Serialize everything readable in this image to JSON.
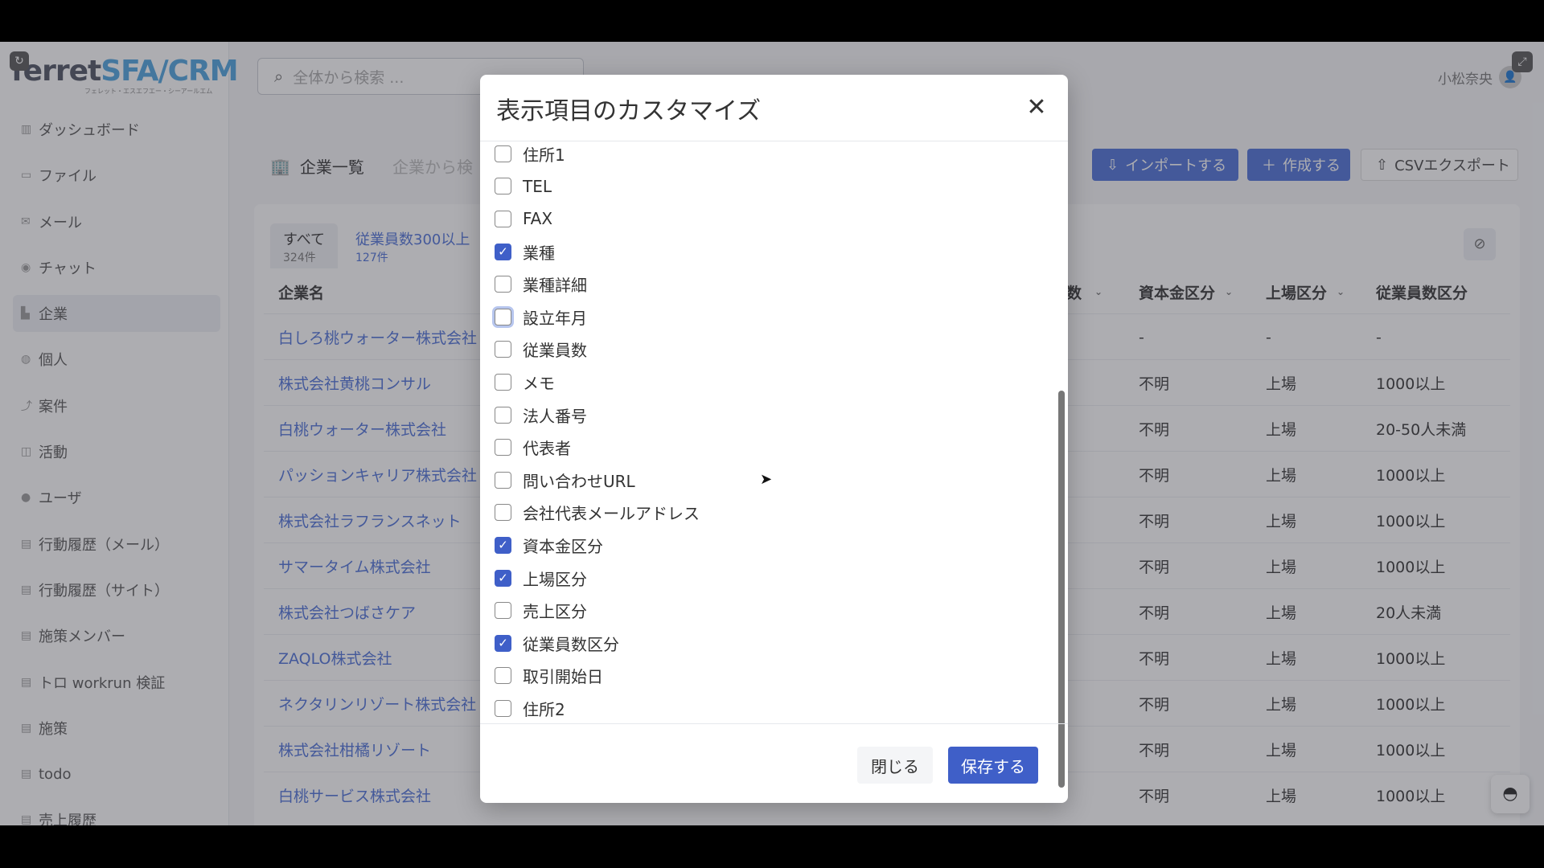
{
  "app": {
    "logo_main": "ferret",
    "logo_accent": "SFA/CRM",
    "logo_sub": "フェレット・エスエフエー・シーアールエム",
    "search_placeholder": "全体から検索 ...",
    "user_name": "小松奈央"
  },
  "sidebar": {
    "items": [
      {
        "icon": "chart-icon",
        "label": "ダッシュボード"
      },
      {
        "icon": "folder-icon",
        "label": "ファイル"
      },
      {
        "icon": "mail-icon",
        "label": "メール"
      },
      {
        "icon": "chat-icon",
        "label": "チャット"
      },
      {
        "icon": "building-icon",
        "label": "企業"
      },
      {
        "icon": "people-icon",
        "label": "個人"
      },
      {
        "icon": "trend-icon",
        "label": "案件"
      },
      {
        "icon": "activity-icon",
        "label": "活動"
      },
      {
        "icon": "user-icon",
        "label": "ユーザ"
      },
      {
        "icon": "doc-icon",
        "label": "行動履歴（メール）"
      },
      {
        "icon": "doc-icon",
        "label": "行動履歴（サイト）"
      },
      {
        "icon": "doc-icon",
        "label": "施策メンバー"
      },
      {
        "icon": "doc-icon",
        "label": "トロ workrun 検証"
      },
      {
        "icon": "doc-icon",
        "label": "施策"
      },
      {
        "icon": "doc-icon",
        "label": "todo"
      },
      {
        "icon": "doc-icon",
        "label": "売上履歴"
      }
    ]
  },
  "page": {
    "title": "企業一覧",
    "search_placeholder": "企業から検",
    "import_label": "インポートする",
    "create_label": "作成する",
    "csv_label": "CSVエクスポート",
    "tabs": [
      {
        "label": "すべて",
        "count": "324件"
      },
      {
        "label": "従業員数300以上",
        "count": "127件"
      }
    ],
    "columns": [
      "企業名",
      "数",
      "資本金区分",
      "上場区分",
      "従業員数区分"
    ],
    "rows": [
      {
        "name": "白しろ桃ウォーター株式会社",
        "capital": "-",
        "listing": "-",
        "employees": "-"
      },
      {
        "name": "株式会社黄桃コンサル",
        "capital": "不明",
        "listing": "上場",
        "employees": "1000以上"
      },
      {
        "name": "白桃ウォーター株式会社",
        "capital": "不明",
        "listing": "上場",
        "employees": "20-50人未満"
      },
      {
        "name": "パッションキャリア株式会社",
        "capital": "不明",
        "listing": "上場",
        "employees": "1000以上"
      },
      {
        "name": "株式会社ラフランスネット",
        "capital": "不明",
        "listing": "上場",
        "employees": "1000以上"
      },
      {
        "name": "サマータイム株式会社",
        "capital": "不明",
        "listing": "上場",
        "employees": "1000以上"
      },
      {
        "name": "株式会社つばさケア",
        "capital": "不明",
        "listing": "上場",
        "employees": "20人未満"
      },
      {
        "name": "ZAQLO株式会社",
        "capital": "不明",
        "listing": "上場",
        "employees": "1000以上"
      },
      {
        "name": "ネクタリンリゾート株式会社",
        "capital": "不明",
        "listing": "上場",
        "employees": "1000以上"
      },
      {
        "name": "株式会社柑橘リゾート",
        "capital": "不明",
        "listing": "上場",
        "employees": "1000以上"
      },
      {
        "name": "白桃サービス株式会社",
        "capital": "不明",
        "listing": "上場",
        "employees": "1000以上"
      }
    ]
  },
  "modal": {
    "title": "表示項目のカスタマイズ",
    "close_label": "閉じる",
    "save_label": "保存する",
    "options": [
      {
        "label": "住所1",
        "checked": false
      },
      {
        "label": "TEL",
        "checked": false
      },
      {
        "label": "FAX",
        "checked": false
      },
      {
        "label": "業種",
        "checked": true
      },
      {
        "label": "業種詳細",
        "checked": false
      },
      {
        "label": "設立年月",
        "checked": false,
        "focused": true
      },
      {
        "label": "従業員数",
        "checked": false
      },
      {
        "label": "メモ",
        "checked": false
      },
      {
        "label": "法人番号",
        "checked": false
      },
      {
        "label": "代表者",
        "checked": false
      },
      {
        "label": "問い合わせURL",
        "checked": false
      },
      {
        "label": "会社代表メールアドレス",
        "checked": false
      },
      {
        "label": "資本金区分",
        "checked": true
      },
      {
        "label": "上場区分",
        "checked": true
      },
      {
        "label": "売上区分",
        "checked": false
      },
      {
        "label": "従業員数区分",
        "checked": true
      },
      {
        "label": "取引開始日",
        "checked": false
      },
      {
        "label": "住所2",
        "checked": false
      }
    ]
  },
  "colors": {
    "accent": "#3f5fc8",
    "link": "#4a6fd8"
  }
}
